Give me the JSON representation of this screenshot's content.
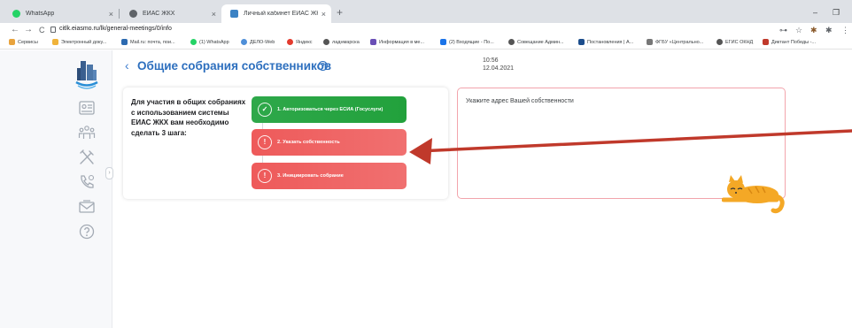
{
  "browser": {
    "tabs": [
      {
        "title": "WhatsApp",
        "favicon_color": "#25D366"
      },
      {
        "title": "ЕИАС ЖКХ",
        "favicon_color": "#5f6368"
      },
      {
        "title": "Личный кабинет ЕИАС ЖКХ",
        "favicon_color": "#3b82c4",
        "active": true
      }
    ],
    "new_tab": "+",
    "close_glyph": "×",
    "window_controls": {
      "minimize": "–",
      "restore": "❐"
    },
    "nav": {
      "back": "←",
      "forward": "→",
      "reload": "C"
    },
    "url": "citlk.eiasmo.ru/lk/general-meetings/0/info",
    "toolbar_icons": {
      "key": "⊶",
      "star": "☆",
      "ext": "✱",
      "menu": "⋮"
    },
    "bookmarks": [
      {
        "label": "Сервисы",
        "color": "#e8a33d"
      },
      {
        "label": "Электронный доку...",
        "color": "#f0b33a"
      },
      {
        "label": "Mail.ru: почта, пои...",
        "color": "#2c6ab0"
      },
      {
        "label": "(1) WhatsApp",
        "color": "#25D366"
      },
      {
        "label": "ДЕЛО-Web",
        "color": "#4f8fd8"
      },
      {
        "label": "Яндекс",
        "color": "#e33b2e"
      },
      {
        "label": "ладнмарска",
        "color": "#555555"
      },
      {
        "label": "Информация в ме...",
        "color": "#6a4fb6"
      },
      {
        "label": "(2) Входящие - По...",
        "color": "#1a73e8"
      },
      {
        "label": "Совещание Админ...",
        "color": "#555555"
      },
      {
        "label": "Постановления | А...",
        "color": "#1c4d8c"
      },
      {
        "label": "ФГБУ «Центрально...",
        "color": "#777777"
      },
      {
        "label": "ЕГИС ОКНД",
        "color": "#555555"
      },
      {
        "label": "Диктант Победы -...",
        "color": "#c0392b"
      }
    ]
  },
  "header": {
    "back": "‹",
    "title": "Общие собрания собственников",
    "help": "?",
    "time": "10:56",
    "date": "12.04.2021"
  },
  "sidebar": {
    "expand": "›",
    "icon_color": "#a3aab4"
  },
  "intro_text": "Для участия в общих собраниях с использованием системы ЕИАС ЖКХ вам необходимо сделать 3 шага:",
  "steps": [
    {
      "label": "1. Авторизоваться через ЕСИА (Госуслуги)",
      "status": "done",
      "mark": "✓",
      "color": "#2ea84a"
    },
    {
      "label": "2. Указать собственность",
      "status": "todo",
      "mark": "!",
      "color": "#ee5a5a"
    },
    {
      "label": "3. Инициировать собрание",
      "status": "todo",
      "mark": "!",
      "color": "#ee5a5a"
    }
  ],
  "address_box": {
    "placeholder": "Укажите адрес Вашей собственности",
    "border_color": "#f2a4ac"
  },
  "annotation": {
    "arrow_color": "#c0392b"
  },
  "colors": {
    "accent": "#2d6fbe",
    "success": "#2ea84a",
    "warning": "#ee5a5a"
  }
}
